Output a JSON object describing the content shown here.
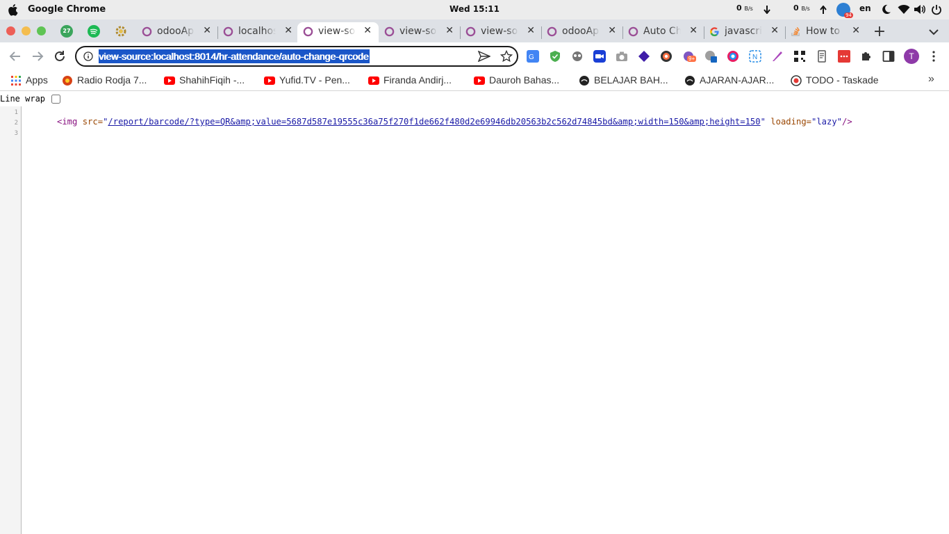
{
  "os_bar": {
    "app_name": "Google Chrome",
    "clock": "Wed 15:11",
    "net_down": "0",
    "net_down_unit": "B/s",
    "net_up": "0",
    "net_up_unit": "B/s",
    "notif_count": "94",
    "lang": "en"
  },
  "tabs": [
    {
      "title": "odooAp",
      "active": false
    },
    {
      "title": "localhos",
      "active": false
    },
    {
      "title": "view-so",
      "active": true
    },
    {
      "title": "view-so",
      "active": false
    },
    {
      "title": "view-so",
      "active": false
    },
    {
      "title": "odooAp",
      "active": false
    },
    {
      "title": "Auto Ch",
      "active": false
    },
    {
      "title": "javascri",
      "active": false
    },
    {
      "title": "How to",
      "active": false
    }
  ],
  "pinned_badge": "27",
  "toolbar": {
    "url": "view-source:localhost:8014/hr-attendance/auto-change-qrcode",
    "avatar_letter": "T",
    "ext_badge": "9+"
  },
  "bookmarks": [
    {
      "label": "Apps"
    },
    {
      "label": "Radio Rodja 7..."
    },
    {
      "label": "ShahihFiqih -..."
    },
    {
      "label": "Yufid.TV - Pen..."
    },
    {
      "label": "Firanda Andirj..."
    },
    {
      "label": "Dauroh Bahas..."
    },
    {
      "label": "BELAJAR BAH..."
    },
    {
      "label": "AJARAN-AJAR..."
    },
    {
      "label": "TODO - Taskade"
    }
  ],
  "source": {
    "line_wrap_label": "Line wrap",
    "line_numbers": [
      "1",
      "2",
      "3"
    ],
    "tag_open": "<img",
    "attr_src": "src=",
    "quote": "\"",
    "src_value": "/report/barcode/?type=QR&amp;value=5687d587e19555c36a75f270f1de662f480d2e69946db20563b2c562d74845bd&amp;width=150&amp;height=150",
    "attr_loading": "loading=",
    "loading_value": "\"lazy\"",
    "tag_close": "/>"
  },
  "colors": {
    "selection": "#1a56c8",
    "tab_strip": "#dee1e6",
    "odoo_purple": "#9b4f96"
  }
}
